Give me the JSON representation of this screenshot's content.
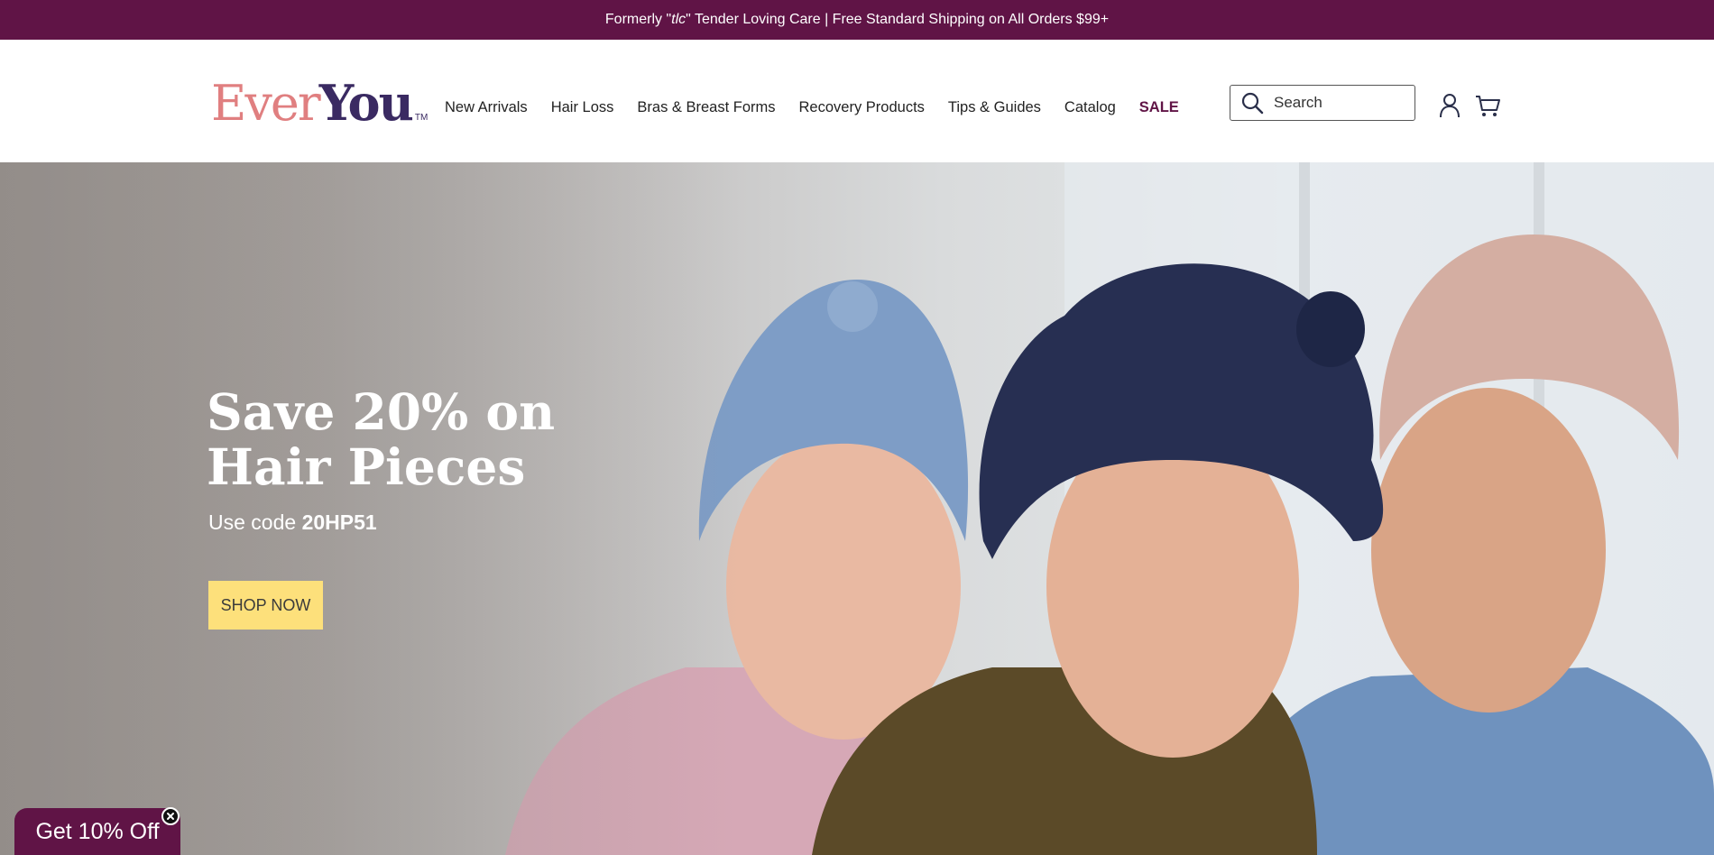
{
  "announcement": {
    "prefix": "Formerly \"",
    "tlc": "tlc",
    "suffix": "\" Tender Loving Care | Free Standard Shipping on All Orders $99+"
  },
  "logo": {
    "part1": "Ever",
    "part2": "You",
    "tm": "TM"
  },
  "nav": {
    "items": [
      "New Arrivals",
      "Hair Loss",
      "Bras & Breast Forms",
      "Recovery Products",
      "Tips & Guides",
      "Catalog",
      "SALE"
    ]
  },
  "search": {
    "placeholder": "Search",
    "icon": "search-icon"
  },
  "header_icons": {
    "account": "account-icon",
    "cart": "cart-icon"
  },
  "hero": {
    "title_line1": "Save 20% on",
    "title_line2": "Hair Pieces",
    "sub_prefix": "Use code ",
    "code": "20HP51",
    "button": "SHOP NOW"
  },
  "discount_tab": {
    "label": "Get 10% Off",
    "close_icon": "close-icon"
  },
  "colors": {
    "brand_plum": "#601446",
    "logo_rose": "#e07f80",
    "logo_navy": "#3a2a62",
    "cta_yellow": "#fde07b"
  }
}
